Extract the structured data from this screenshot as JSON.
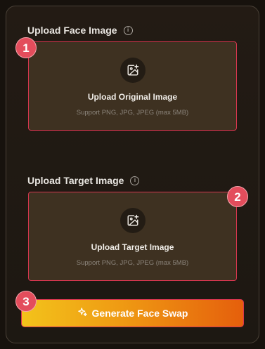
{
  "face_section": {
    "title": "Upload Face Image",
    "info_icon": "info-icon",
    "dropzone_title": "Upload Original Image",
    "dropzone_subtitle": "Support PNG, JPG, JPEG (max 5MB)",
    "upload_icon": "image-plus-icon"
  },
  "target_section": {
    "title": "Upload Target Image",
    "info_icon": "info-icon",
    "dropzone_title": "Upload Target Image",
    "dropzone_subtitle": "Support PNG, JPG, JPEG (max 5MB)",
    "upload_icon": "image-plus-icon"
  },
  "generate_button": {
    "label": "Generate Face Swap",
    "icon": "sparkle-icon"
  },
  "annotations": [
    "1",
    "2",
    "3"
  ],
  "colors": {
    "background": "#17120d",
    "panel": "#231b14",
    "dropzone": "#3e3121",
    "highlight_border": "#d8364f",
    "badge": "#e34d5c",
    "button_gradient_start": "#f3c31b",
    "button_gradient_end": "#e55f0c"
  }
}
